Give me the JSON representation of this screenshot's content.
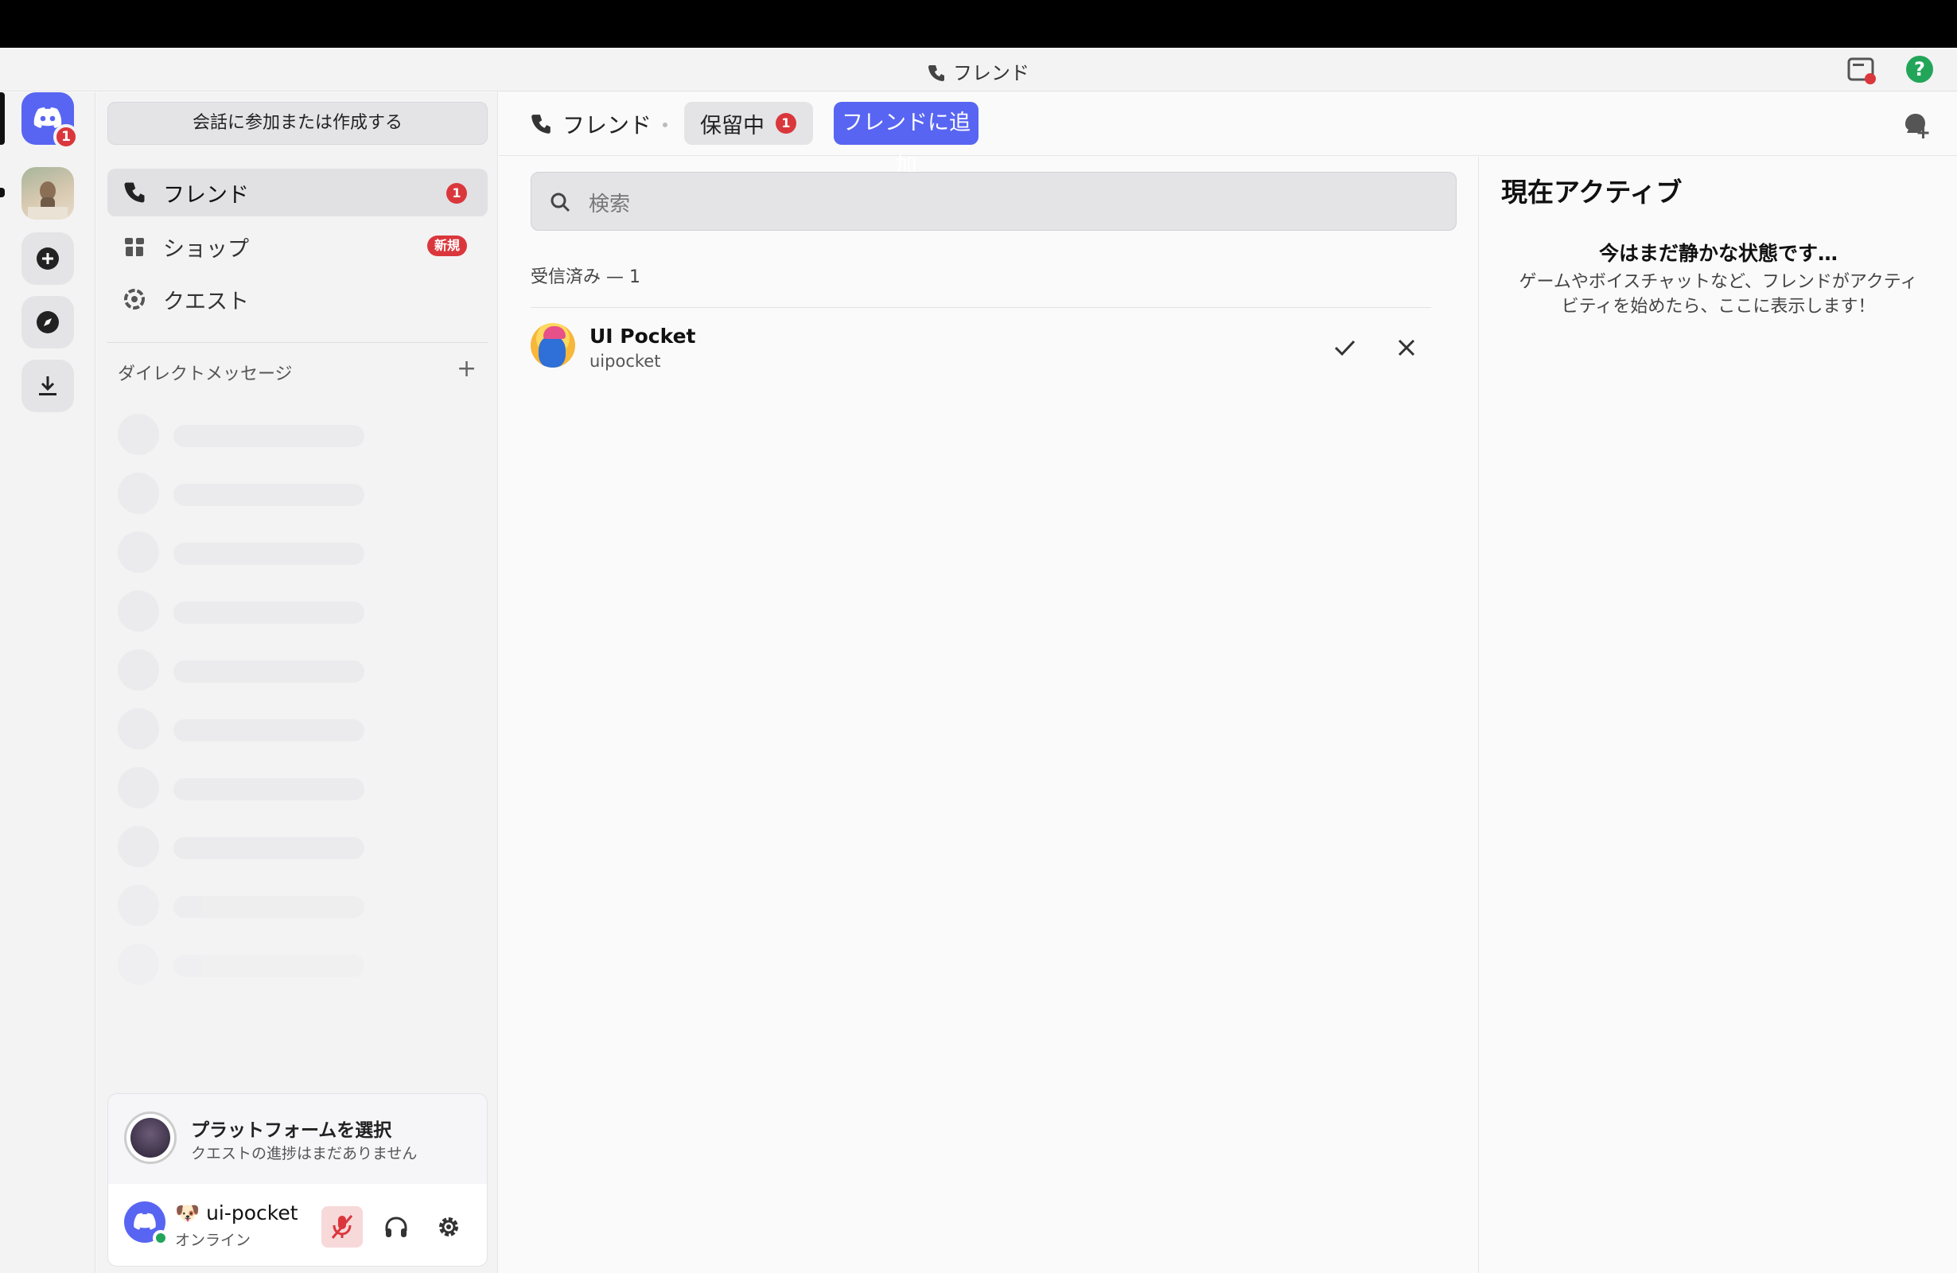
{
  "window": {
    "title": "フレンド"
  },
  "sidebar": {
    "join_button": "会話に参加または作成する",
    "nav": [
      {
        "label": "フレンド",
        "badge": "1"
      },
      {
        "label": "ショップ",
        "badge": "新規"
      },
      {
        "label": "クエスト"
      }
    ],
    "dm_header": "ダイレクトメッセージ",
    "dm_add": "+"
  },
  "rail": {
    "home_badge": "1"
  },
  "quest": {
    "title": "プラットフォームを選択",
    "subtitle": "クエストの進捗はまだありません"
  },
  "user": {
    "name": "🐶 ui-pocket",
    "status": "オンライン"
  },
  "header": {
    "friends_label": "フレンド",
    "pending_label": "保留中",
    "pending_badge": "1",
    "add_friend_label": "フレンドに追加"
  },
  "search": {
    "placeholder": "検索"
  },
  "requests": {
    "section_label": "受信済み — 1",
    "items": [
      {
        "display_name": "UI Pocket",
        "username": "uipocket"
      }
    ]
  },
  "active_now": {
    "title": "現在アクティブ",
    "empty_title": "今はまだ静かな状態です…",
    "empty_desc": "ゲームやボイスチャットなど、フレンドがアクティビティを始めたら、ここに表示します！"
  },
  "colors": {
    "accent": "#5865f2",
    "danger": "#da373c",
    "online": "#23a559"
  },
  "icons": [
    "friends-icon",
    "shop-icon",
    "quest-icon",
    "search-icon",
    "check-icon",
    "close-icon",
    "mic-muted-icon",
    "headphones-icon",
    "gear-icon",
    "new-dm-icon",
    "help-icon",
    "inbox-icon",
    "add-server-icon",
    "discover-icon",
    "download-icon"
  ]
}
